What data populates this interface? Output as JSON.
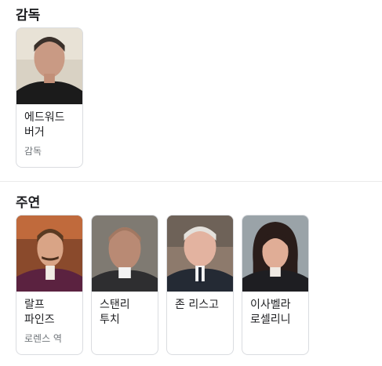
{
  "director_section": {
    "title": "감독",
    "cards": [
      {
        "name": "에드워드 버거",
        "role": "감독",
        "photo_icon": "person-photo"
      }
    ]
  },
  "cast_section": {
    "title": "주연",
    "cards": [
      {
        "name": "랄프 파인즈",
        "role": "로렌스 역",
        "photo_icon": "person-photo"
      },
      {
        "name": "스탠리 투치",
        "role": "",
        "photo_icon": "person-photo"
      },
      {
        "name": "존 리스고",
        "role": "",
        "photo_icon": "person-photo"
      },
      {
        "name": "이사벨라 로셀리니",
        "role": "",
        "photo_icon": "person-photo"
      }
    ]
  }
}
